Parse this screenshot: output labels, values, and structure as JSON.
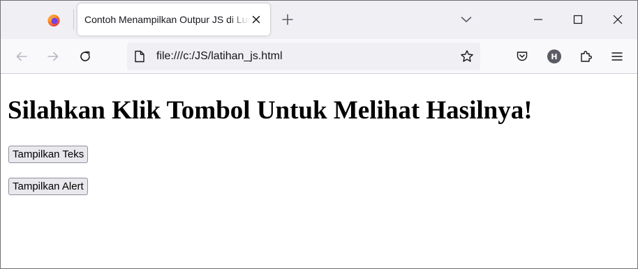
{
  "browser": {
    "tab": {
      "title": "Contoh Menampilkan Outpur JS di Luar"
    },
    "address_bar": {
      "url": "file:///c:/JS/latihan_js.html"
    },
    "profile_avatar_letter": "H",
    "icons": {
      "browser_logo": "firefox-icon",
      "close_tab": "close-icon",
      "new_tab": "plus-icon",
      "list_tabs": "chevron-down-icon",
      "minimize": "minimize-icon",
      "maximize": "maximize-icon",
      "close_window": "close-icon",
      "back": "back-arrow-icon",
      "forward": "forward-arrow-icon",
      "reload": "reload-icon",
      "page_info": "page-icon",
      "bookmark": "star-icon",
      "pocket": "pocket-icon",
      "extensions": "puzzle-icon",
      "menu": "hamburger-menu-icon"
    }
  },
  "page": {
    "heading": "Silahkan Klik Tombol Untuk Melihat Hasilnya!",
    "buttons": {
      "show_text": "Tampilkan Teks",
      "show_alert": "Tampilkan Alert"
    }
  },
  "colors": {
    "tabstrip_bg": "#f0f0f4",
    "navbar_bg": "#f9f9fb",
    "urlbar_bg": "#f0f0f4",
    "button_bg": "#e9e9ed",
    "button_border": "#8f8f9d",
    "icon": "#5b5b66",
    "text": "#15141a"
  }
}
